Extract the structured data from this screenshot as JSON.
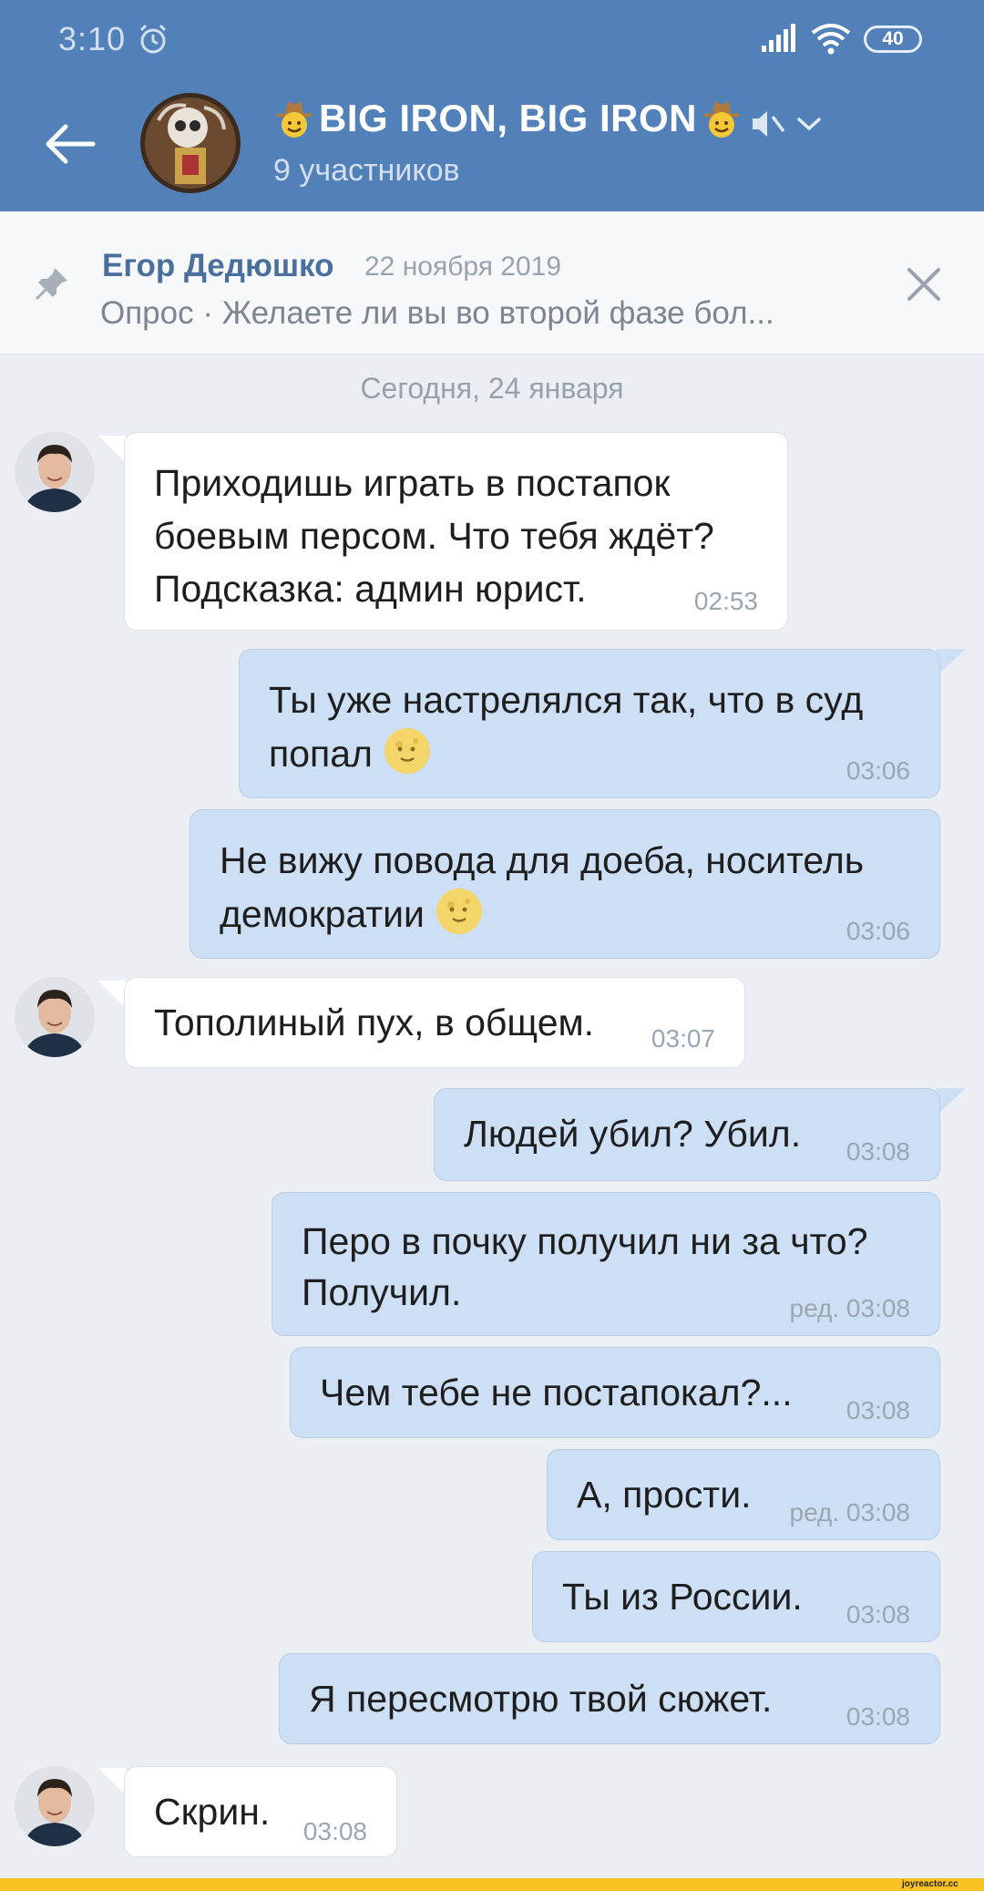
{
  "status": {
    "time": "3:10",
    "battery": "40"
  },
  "header": {
    "title": "BIG IRON, BIG IRON",
    "subtitle": "9 участников"
  },
  "pinned": {
    "author": "Егор Дедюшко",
    "date": "22 ноября 2019",
    "text": "Опрос · Желаете ли вы во второй фазе бол..."
  },
  "date_separator": "Сегодня, 24 января",
  "messages": [
    {
      "dir": "in",
      "lines": [
        "Приходишь играть в постапок",
        "боевым персом. Что тебя ждёт?",
        "Подсказка: админ юрист."
      ],
      "time": "02:53"
    },
    {
      "dir": "out",
      "lines": [
        "Ты уже настрелялся так, что в суд",
        "попал"
      ],
      "time": "03:06"
    },
    {
      "dir": "out",
      "lines": [
        "Не вижу повода для доеба, носитель",
        "демократии"
      ],
      "time": "03:06"
    },
    {
      "dir": "in",
      "lines": [
        "Тополиный пух, в общем."
      ],
      "time": "03:07"
    },
    {
      "dir": "out",
      "lines": [
        "Людей убил? Убил."
      ],
      "time": "03:08"
    },
    {
      "dir": "out",
      "lines": [
        "Перо в почку получил ни за что?",
        "Получил."
      ],
      "time": "ред. 03:08"
    },
    {
      "dir": "out",
      "lines": [
        "Чем тебе не постапокал?..."
      ],
      "time": "03:08"
    },
    {
      "dir": "out",
      "lines": [
        "А, прости."
      ],
      "time": "ред. 03:08"
    },
    {
      "dir": "out",
      "lines": [
        "Ты из России."
      ],
      "time": "03:08"
    },
    {
      "dir": "out",
      "lines": [
        "Я пересмотрю твой сюжет."
      ],
      "time": "03:08"
    },
    {
      "dir": "in",
      "lines": [
        "Скрин."
      ],
      "time": "03:08"
    }
  ],
  "watermark": "joyreactor.cc",
  "colors": {
    "header": "#5181b8",
    "outgoing": "#cddff5",
    "incoming": "#ffffff",
    "background": "#ebeef2",
    "footer": "#f9c221"
  }
}
